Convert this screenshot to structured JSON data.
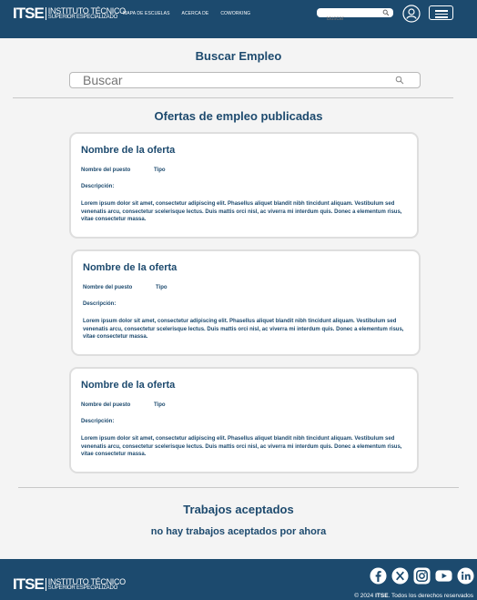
{
  "header": {
    "logo_mark": "ITSE",
    "logo_line1": "INSTITUTO TÉCNICO",
    "logo_line2": "SUPERIOR ESPECIALIZADO",
    "nav": [
      "MAPA DE ESCUELAS",
      "ACERCA DE",
      "COWORKING"
    ],
    "search_placeholder": "Buscar",
    "icons": [
      "search-icon",
      "user-icon",
      "hamburger-menu-icon"
    ]
  },
  "main": {
    "search_title": "Buscar Empleo",
    "search_placeholder": "Buscar",
    "offers_title": "Ofertas de empleo publicadas",
    "offers": [
      {
        "name": "Nombre de la oferta",
        "puesto": "Nombre del puesto",
        "tipo": "Tipo",
        "desc_label": "Descripción:",
        "desc": "Lorem ipsum dolor sit amet, consectetur adipiscing elit. Phasellus aliquet blandit nibh tincidunt aliquam. Vestibulum sed venenatis arcu, consectetur scelerisque lectus. Duis mattis orci nisl, ac viverra mi interdum quis. Donec a elementum risus, vitae consectetur massa."
      },
      {
        "name": "Nombre de la oferta",
        "puesto": "Nombre del puesto",
        "tipo": "Tipo",
        "desc_label": "Descripción:",
        "desc": "Lorem ipsum dolor sit amet, consectetur adipiscing elit. Phasellus aliquet blandit nibh tincidunt aliquam. Vestibulum sed venenatis arcu, consectetur scelerisque lectus. Duis mattis orci nisl, ac viverra mi interdum quis. Donec a elementum risus, vitae consectetur massa."
      },
      {
        "name": "Nombre de la oferta",
        "puesto": "Nombre del puesto",
        "tipo": "Tipo",
        "desc_label": "Descripción:",
        "desc": "Lorem ipsum dolor sit amet, consectetur adipiscing elit. Phasellus aliquet blandit nibh tincidunt aliquam. Vestibulum sed venenatis arcu, consectetur scelerisque lectus. Duis mattis orci nisl, ac viverra mi interdum quis. Donec a elementum risus, vitae consectetur massa."
      }
    ],
    "accepted_title": "Trabajos aceptados",
    "accepted_empty": "no hay trabajos aceptados por ahora"
  },
  "footer": {
    "logo_mark": "ITSE",
    "logo_line1": "INSTITUTO TÉCNICO",
    "logo_line2": "SUPERIOR ESPECIALIZADO",
    "socials": [
      "facebook-icon",
      "x-icon",
      "instagram-icon",
      "youtube-icon",
      "linkedin-icon"
    ],
    "copyright_prefix": "© 2024 ",
    "copyright_brand": "ITSE",
    "copyright_suffix": ". Todos los derechos reservados"
  },
  "colors": {
    "brand": "#1c4a6e",
    "background": "#f4f4f4",
    "card_border": "#dedede"
  }
}
